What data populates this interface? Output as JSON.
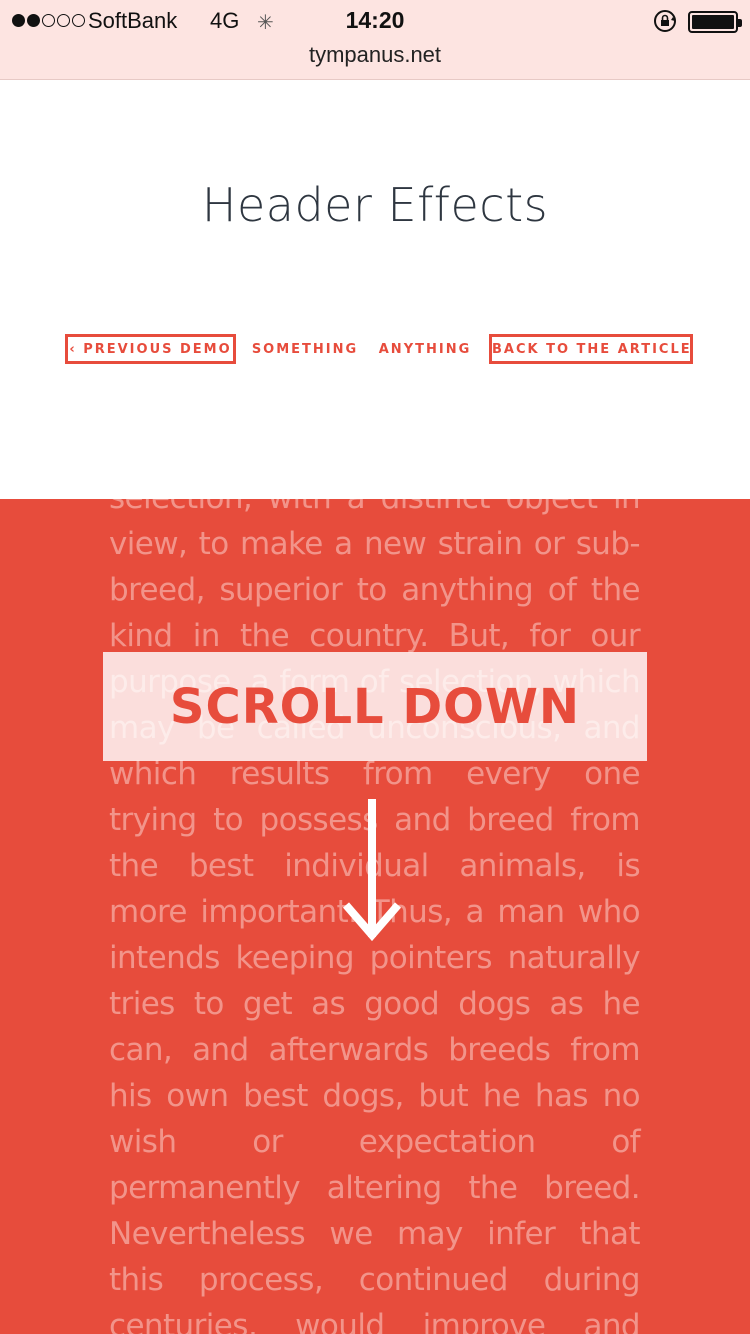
{
  "status_bar": {
    "carrier": "SoftBank",
    "network": "4G",
    "time": "14:20",
    "signal_strength": 2,
    "signal_max": 5,
    "battery_level": 1.0,
    "icons": [
      "signal-dots-icon",
      "activity-spinner-icon",
      "rotation-lock-icon",
      "battery-icon"
    ]
  },
  "browser": {
    "url": "tympanus.net"
  },
  "header": {
    "title": "Header Effects",
    "nav": {
      "previous": "‹ Previous Demo",
      "something": "Something",
      "anything": "Anything",
      "back": "Back to the Article"
    }
  },
  "main": {
    "article_text": "selection, with a distinct object in view, to make a new strain or sub-breed, superior to anything of the kind in the country. But, for our purpose, a form of selection, which may be called unconscious, and which results from every one trying to possess and breed from the best individual animals, is more important. Thus, a man who intends keeping pointers naturally tries to get as good dogs as he can, and afterwards breeds from his own best dogs, but he has no wish or expectation of permanently altering the breed. Nevertheless we may infer that this process, continued during centuries, would improve and modify any breed, in",
    "scroll_label": "SCROLL DOWN"
  },
  "colors": {
    "accent": "#e74c3c",
    "status_bar_bg": "#fde4e1",
    "title_text": "#2e3640",
    "article_text": "#f2948a"
  }
}
